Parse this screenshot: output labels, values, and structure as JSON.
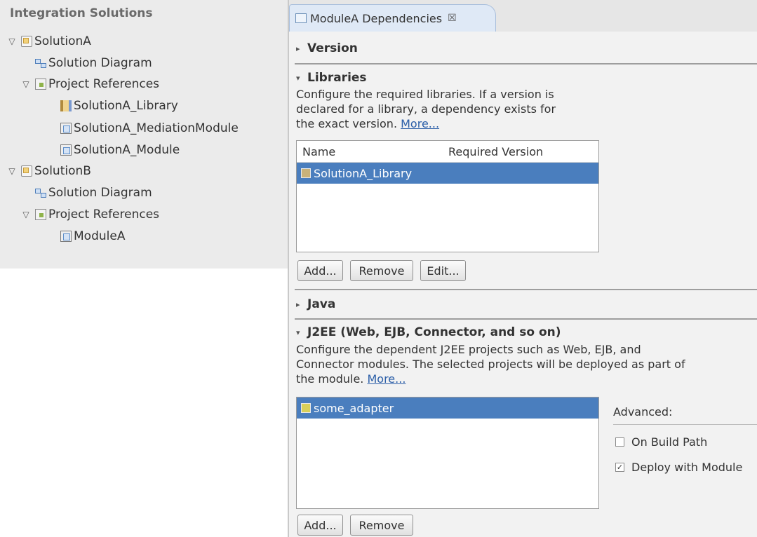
{
  "navigator": {
    "title": "Integration Solutions",
    "solution_a": {
      "label": "SolutionA",
      "diagram": "Solution Diagram",
      "project_references": "Project References",
      "refs": [
        "SolutionA_Library",
        "SolutionA_MediationModule",
        "SolutionA_Module"
      ]
    },
    "solution_b": {
      "label": "SolutionB",
      "diagram": "Solution Diagram",
      "project_references": "Project References",
      "refs": [
        "ModuleA"
      ]
    },
    "expanded_glyph": "▽"
  },
  "editor": {
    "tab_title": "ModuleA Dependencies",
    "tab_close": "☒",
    "collapsed_arrow": "▸",
    "expanded_arrow": "▾",
    "version": {
      "title": "Version"
    },
    "libraries": {
      "title": "Libraries",
      "desc_1": "Configure the required libraries.  If a version is",
      "desc_2": "declared for a library, a dependency exists for",
      "desc_3": "the exact version.",
      "more": "More...",
      "col_name": "Name",
      "col_version": "Required Version",
      "rows": [
        "SolutionA_Library"
      ],
      "add": "Add...",
      "remove": "Remove",
      "edit": "Edit..."
    },
    "java": {
      "title": "Java"
    },
    "j2ee": {
      "title": "J2EE (Web, EJB, Connector, and so on)",
      "desc_1": "Configure the dependent J2EE projects such as Web, EJB, and",
      "desc_2": "Connector modules.  The selected projects will be deployed as part of",
      "desc_3": "the module.",
      "more": "More...",
      "rows": [
        "some_adapter"
      ],
      "advanced": "Advanced:",
      "on_build_path": "On Build Path",
      "deploy_with_module": "Deploy with Module",
      "on_build_path_checked": false,
      "deploy_with_module_checked": true,
      "add": "Add...",
      "remove": "Remove"
    }
  }
}
